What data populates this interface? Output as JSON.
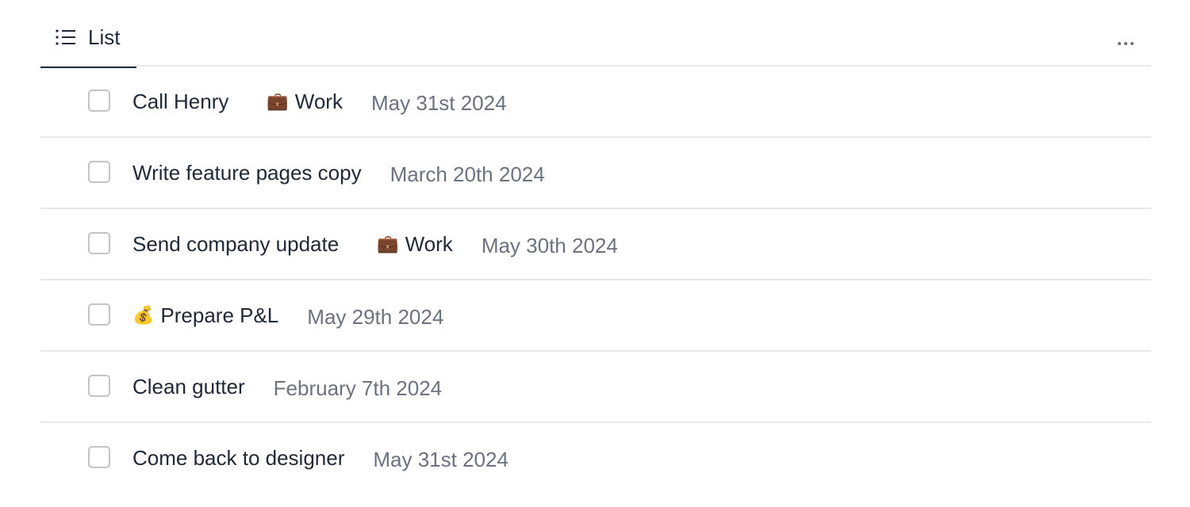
{
  "tabs": [
    {
      "label": "List",
      "icon": "list-icon",
      "active": true
    }
  ],
  "more_menu_icon": "more-horizontal-icon",
  "tasks": [
    {
      "title": "Call Henry",
      "title_emoji": "",
      "tag": {
        "emoji": "💼",
        "label": "Work"
      },
      "date": "May 31st 2024",
      "checked": false
    },
    {
      "title": "Write feature pages copy",
      "title_emoji": "",
      "tag": null,
      "date": "March 20th 2024",
      "checked": false
    },
    {
      "title": "Send company update",
      "title_emoji": "",
      "tag": {
        "emoji": "💼",
        "label": "Work"
      },
      "date": "May 30th 2024",
      "checked": false
    },
    {
      "title": "Prepare P&L",
      "title_emoji": "💰",
      "tag": null,
      "date": "May 29th 2024",
      "checked": false
    },
    {
      "title": "Clean gutter",
      "title_emoji": "",
      "tag": null,
      "date": "February 7th 2024",
      "checked": false
    },
    {
      "title": "Come back to designer",
      "title_emoji": "",
      "tag": null,
      "date": "May 31st 2024",
      "checked": false
    }
  ]
}
